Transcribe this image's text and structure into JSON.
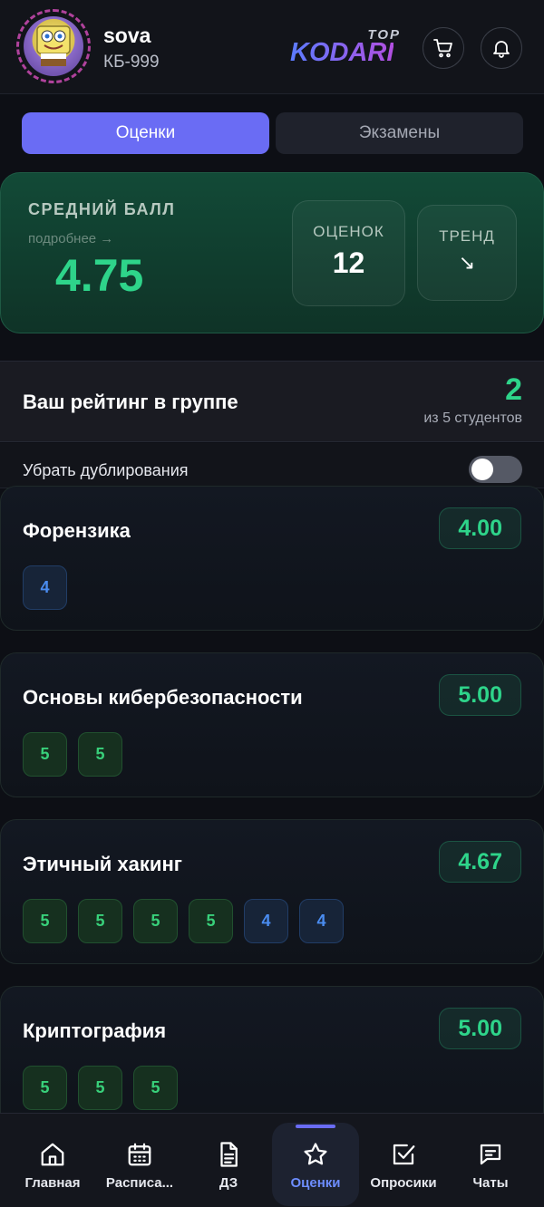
{
  "header": {
    "username": "sova",
    "group": "КБ-999",
    "logo_top": "TOP",
    "logo_main": "KODARI"
  },
  "tabs": [
    {
      "label": "Оценки",
      "active": true
    },
    {
      "label": "Экзамены",
      "active": false
    }
  ],
  "average": {
    "label": "СРЕДНИЙ БАЛЛ",
    "more": "подробнее →",
    "value": "4.75",
    "count_label": "ОЦЕНОК",
    "count": "12",
    "trend_label": "ТРЕНД",
    "trend": "↘"
  },
  "rating": {
    "title": "Ваш рейтинг в группе",
    "place": "2",
    "subtitle": "из 5 студентов"
  },
  "dedup": {
    "label": "Убрать дублирования",
    "enabled": false
  },
  "subjects": [
    {
      "name": "Форензика",
      "avg": "4.00",
      "grades": [
        "4"
      ]
    },
    {
      "name": "Основы кибербезопасности",
      "avg": "5.00",
      "grades": [
        "5",
        "5"
      ]
    },
    {
      "name": "Этичный хакинг",
      "avg": "4.67",
      "grades": [
        "5",
        "5",
        "5",
        "5",
        "4",
        "4"
      ]
    },
    {
      "name": "Криптография",
      "avg": "5.00",
      "grades": [
        "5",
        "5",
        "5"
      ]
    }
  ],
  "nav": [
    {
      "label": "Главная",
      "icon": "home-icon"
    },
    {
      "label": "Расписа...",
      "icon": "calendar-icon"
    },
    {
      "label": "ДЗ",
      "icon": "document-icon"
    },
    {
      "label": "Оценки",
      "icon": "star-icon",
      "active": true
    },
    {
      "label": "Опросики",
      "icon": "checkbox-icon"
    },
    {
      "label": "Чаты",
      "icon": "chat-icon"
    }
  ],
  "colors": {
    "accent": "#6a6cf4",
    "success": "#2ed48a",
    "grade_good": "#38d07a",
    "grade_ok": "#4a8cf0"
  }
}
